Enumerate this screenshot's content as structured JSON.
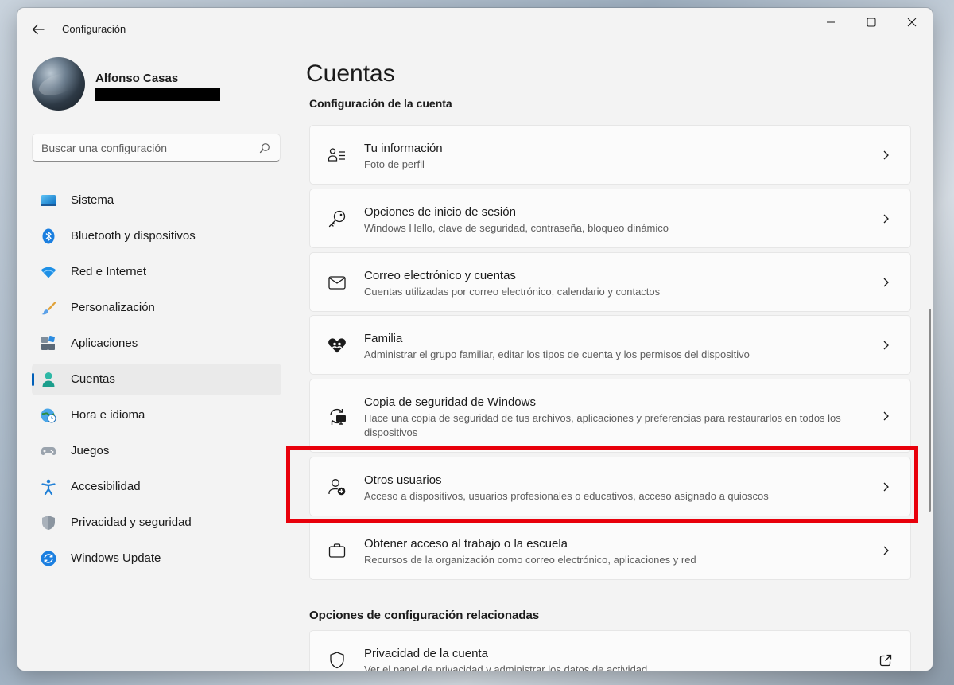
{
  "window": {
    "title": "Configuración"
  },
  "profile": {
    "name": "Alfonso Casas"
  },
  "search": {
    "placeholder": "Buscar una configuración"
  },
  "sidebar": {
    "items": [
      {
        "label": "Sistema",
        "icon": "monitor-icon"
      },
      {
        "label": "Bluetooth y dispositivos",
        "icon": "bluetooth-icon"
      },
      {
        "label": "Red e Internet",
        "icon": "wifi-icon"
      },
      {
        "label": "Personalización",
        "icon": "brush-icon"
      },
      {
        "label": "Aplicaciones",
        "icon": "apps-icon"
      },
      {
        "label": "Cuentas",
        "icon": "person-icon",
        "selected": true
      },
      {
        "label": "Hora e idioma",
        "icon": "clock-globe-icon"
      },
      {
        "label": "Juegos",
        "icon": "gamepad-icon"
      },
      {
        "label": "Accesibilidad",
        "icon": "accessibility-icon"
      },
      {
        "label": "Privacidad y seguridad",
        "icon": "shield-icon"
      },
      {
        "label": "Windows Update",
        "icon": "update-icon"
      }
    ]
  },
  "main": {
    "title": "Cuentas",
    "section1": "Configuración de la cuenta",
    "cards": [
      {
        "title": "Tu información",
        "desc": "Foto de perfil",
        "icon": "person-info-icon"
      },
      {
        "title": "Opciones de inicio de sesión",
        "desc": "Windows Hello, clave de seguridad, contraseña, bloqueo dinámico",
        "icon": "key-icon"
      },
      {
        "title": "Correo electrónico y cuentas",
        "desc": "Cuentas utilizadas por correo electrónico, calendario y contactos",
        "icon": "mail-icon"
      },
      {
        "title": "Familia",
        "desc": "Administrar el grupo familiar, editar los tipos de cuenta y los permisos del dispositivo",
        "icon": "family-heart-icon"
      },
      {
        "title": "Copia de seguridad de Windows",
        "desc": "Hace una copia de seguridad de tus archivos, aplicaciones y preferencias para restaurarlos en todos los dispositivos",
        "icon": "backup-icon"
      },
      {
        "title": "Otros usuarios",
        "desc": "Acceso a dispositivos, usuarios profesionales o educativos, acceso asignado a quioscos",
        "icon": "person-add-icon"
      },
      {
        "title": "Obtener acceso al trabajo o la escuela",
        "desc": "Recursos de la organización como correo electrónico, aplicaciones y red",
        "icon": "briefcase-icon"
      }
    ],
    "section2": "Opciones de configuración relacionadas",
    "related": [
      {
        "title": "Privacidad de la cuenta",
        "desc": "Ver el panel de privacidad y administrar los datos de actividad",
        "icon": "shield-outline-icon"
      }
    ]
  },
  "colors": {
    "accent": "#005fb8",
    "highlight": "#e8000b"
  }
}
